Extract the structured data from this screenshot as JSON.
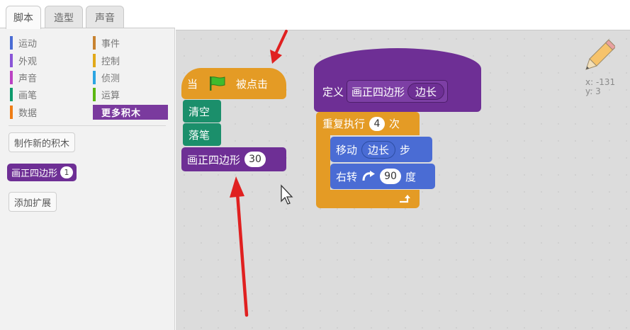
{
  "tabs": [
    {
      "label": "脚本",
      "active": true
    },
    {
      "label": "造型",
      "active": false
    },
    {
      "label": "声音",
      "active": false
    }
  ],
  "categories_left": [
    {
      "label": "运动",
      "color": "#4a6cd4"
    },
    {
      "label": "外观",
      "color": "#8a55d7"
    },
    {
      "label": "声音",
      "color": "#bb42c3"
    },
    {
      "label": "画笔",
      "color": "#0e9a6c"
    },
    {
      "label": "数据",
      "color": "#ee7d16"
    }
  ],
  "categories_right": [
    {
      "label": "事件",
      "color": "#c88330"
    },
    {
      "label": "控制",
      "color": "#e1a91a"
    },
    {
      "label": "侦测",
      "color": "#2ca5e2"
    },
    {
      "label": "运算",
      "color": "#5cb712"
    },
    {
      "label": "更多积木",
      "color": "#7a3a9e",
      "selected": true
    }
  ],
  "palette": {
    "make_block_button": "制作新的积木",
    "custom_block_label": "画正四边形",
    "custom_block_arg": "1",
    "add_extension_button": "添加扩展"
  },
  "script1": {
    "when_label": "当",
    "clicked_label": "被点击",
    "clear_label": "清空",
    "pen_down_label": "落笔",
    "call_label": "画正四边形",
    "call_arg": "30"
  },
  "script2": {
    "define_label": "定义",
    "proc_name": "画正四边形",
    "param_name": "边长",
    "repeat_label": "重复执行",
    "repeat_count": "4",
    "times_label": "次",
    "move_label": "移动",
    "move_arg": "边长",
    "steps_label": "步",
    "turn_label": "右转",
    "turn_arg": "90",
    "degrees_label": "度"
  },
  "readout": {
    "x": "x: -131",
    "y": "y: 3"
  },
  "annotation_color": "#e02020"
}
